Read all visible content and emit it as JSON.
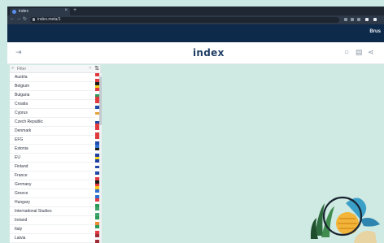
{
  "browser": {
    "tab_title": "index",
    "tab_close": "×",
    "new_tab": "+",
    "url": "index.meta/1"
  },
  "sitebar": {
    "link": "Brus"
  },
  "header": {
    "logo": "index",
    "icons": [
      "sidebar-toggle-icon",
      "search-icon",
      "document-icon",
      "share-icon"
    ]
  },
  "sidebar": {
    "search_placeholder": "Filter",
    "items": [
      {
        "label": "Austria",
        "flag": [
          "#e03a3e",
          "#ffffff",
          "#e03a3e"
        ]
      },
      {
        "label": "Belgium",
        "flag": [
          "#1a1a1a",
          "#f7d417",
          "#e03a3e"
        ]
      },
      {
        "label": "Bulgaria",
        "flag": [
          "#ffffff",
          "#2b9a59",
          "#e03a3e"
        ]
      },
      {
        "label": "Croatia",
        "flag": [
          "#e03a3e",
          "#ffffff",
          "#1f4aa8"
        ]
      },
      {
        "label": "Cyprus",
        "flag": [
          "#ffffff",
          "#e7a13a",
          "#ffffff"
        ]
      },
      {
        "label": "Czech Republic",
        "flag": [
          "#ffffff",
          "#1f4aa8",
          "#e03a3e"
        ]
      },
      {
        "label": "Denmark",
        "flag": [
          "#e03a3e",
          "#ffffff",
          "#e03a3e"
        ]
      },
      {
        "label": "EFG",
        "flag": [
          "#e03a3e",
          "#ffffff",
          "#1f4aa8"
        ]
      },
      {
        "label": "Estonia",
        "flag": [
          "#2b6fd1",
          "#1a1a1a",
          "#ffffff"
        ]
      },
      {
        "label": "EU",
        "flag": [
          "#1f3fa0",
          "#f7d417",
          "#1f3fa0"
        ]
      },
      {
        "label": "Finland",
        "flag": [
          "#ffffff",
          "#1f4aa8",
          "#ffffff"
        ]
      },
      {
        "label": "France",
        "flag": [
          "#1f4aa8",
          "#ffffff",
          "#e03a3e"
        ]
      },
      {
        "label": "Germany",
        "flag": [
          "#1a1a1a",
          "#e03a3e",
          "#f7c417"
        ]
      },
      {
        "label": "Greece",
        "flag": [
          "#2b6fd1",
          "#ffffff",
          "#2b6fd1"
        ]
      },
      {
        "label": "Hungary",
        "flag": [
          "#e03a3e",
          "#ffffff",
          "#2b9a59"
        ]
      },
      {
        "label": "International Studies",
        "flag": [
          "#3fa56b",
          "#ffffff",
          "#3fa56b"
        ]
      },
      {
        "label": "Ireland",
        "flag": [
          "#2b9a59",
          "#ffffff",
          "#ee8a2f"
        ]
      },
      {
        "label": "Italy",
        "flag": [
          "#2b9a59",
          "#ffffff",
          "#e03a3e"
        ]
      },
      {
        "label": "Latvia",
        "flag": [
          "#9e2b35",
          "#ffffff",
          "#9e2b35"
        ]
      }
    ]
  },
  "colors": {
    "page_bg": "#cfe9e3",
    "chrome_dark": "#1f2733",
    "site_bar": "#0e2a4a",
    "logo": "#1f3e63"
  }
}
